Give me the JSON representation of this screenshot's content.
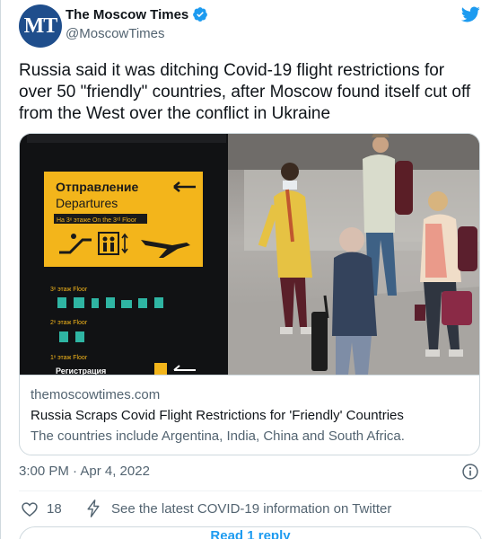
{
  "account": {
    "avatar_text": "MT",
    "name": "The Moscow Times",
    "handle": "@MoscowTimes"
  },
  "tweet": {
    "text": "Russia said it was ditching Covid-19 flight restrictions for over 50 \"friendly\" countries, after Moscow found itself cut off from the West over the conflict in Ukraine",
    "timestamp": "3:00 PM · Apr 4, 2022",
    "likes": "18",
    "covid_link": "See the latest COVID-19 information on Twitter",
    "read_button": "Read 1 reply"
  },
  "card": {
    "domain": "themoscowtimes.com",
    "title": "Russia Scraps Covid Flight Restrictions for 'Friendly' Countries",
    "description": "The countries include Argentina, India, China and South Africa."
  },
  "airport_sign": {
    "line_ru": "Отправление",
    "line_en": "Departures",
    "floor_note": "На 3ˣ этаже On the 3ʳᵈ Floor",
    "floor3": "3ˣ этаж Floor",
    "floor2": "2ˣ этаж Floor",
    "floor1": "1ˣ этаж Floor",
    "bottom_text": "Регистрация"
  },
  "icons": {
    "verified": "verified-badge-icon",
    "twitter": "twitter-bird-icon",
    "info": "info-icon",
    "like": "heart-icon",
    "bolt": "lightning-bolt-icon"
  },
  "colors": {
    "twitter_blue": "#1d9bf0",
    "sign_yellow": "#f3b51b",
    "avatar_blue": "#1f4e8c"
  }
}
